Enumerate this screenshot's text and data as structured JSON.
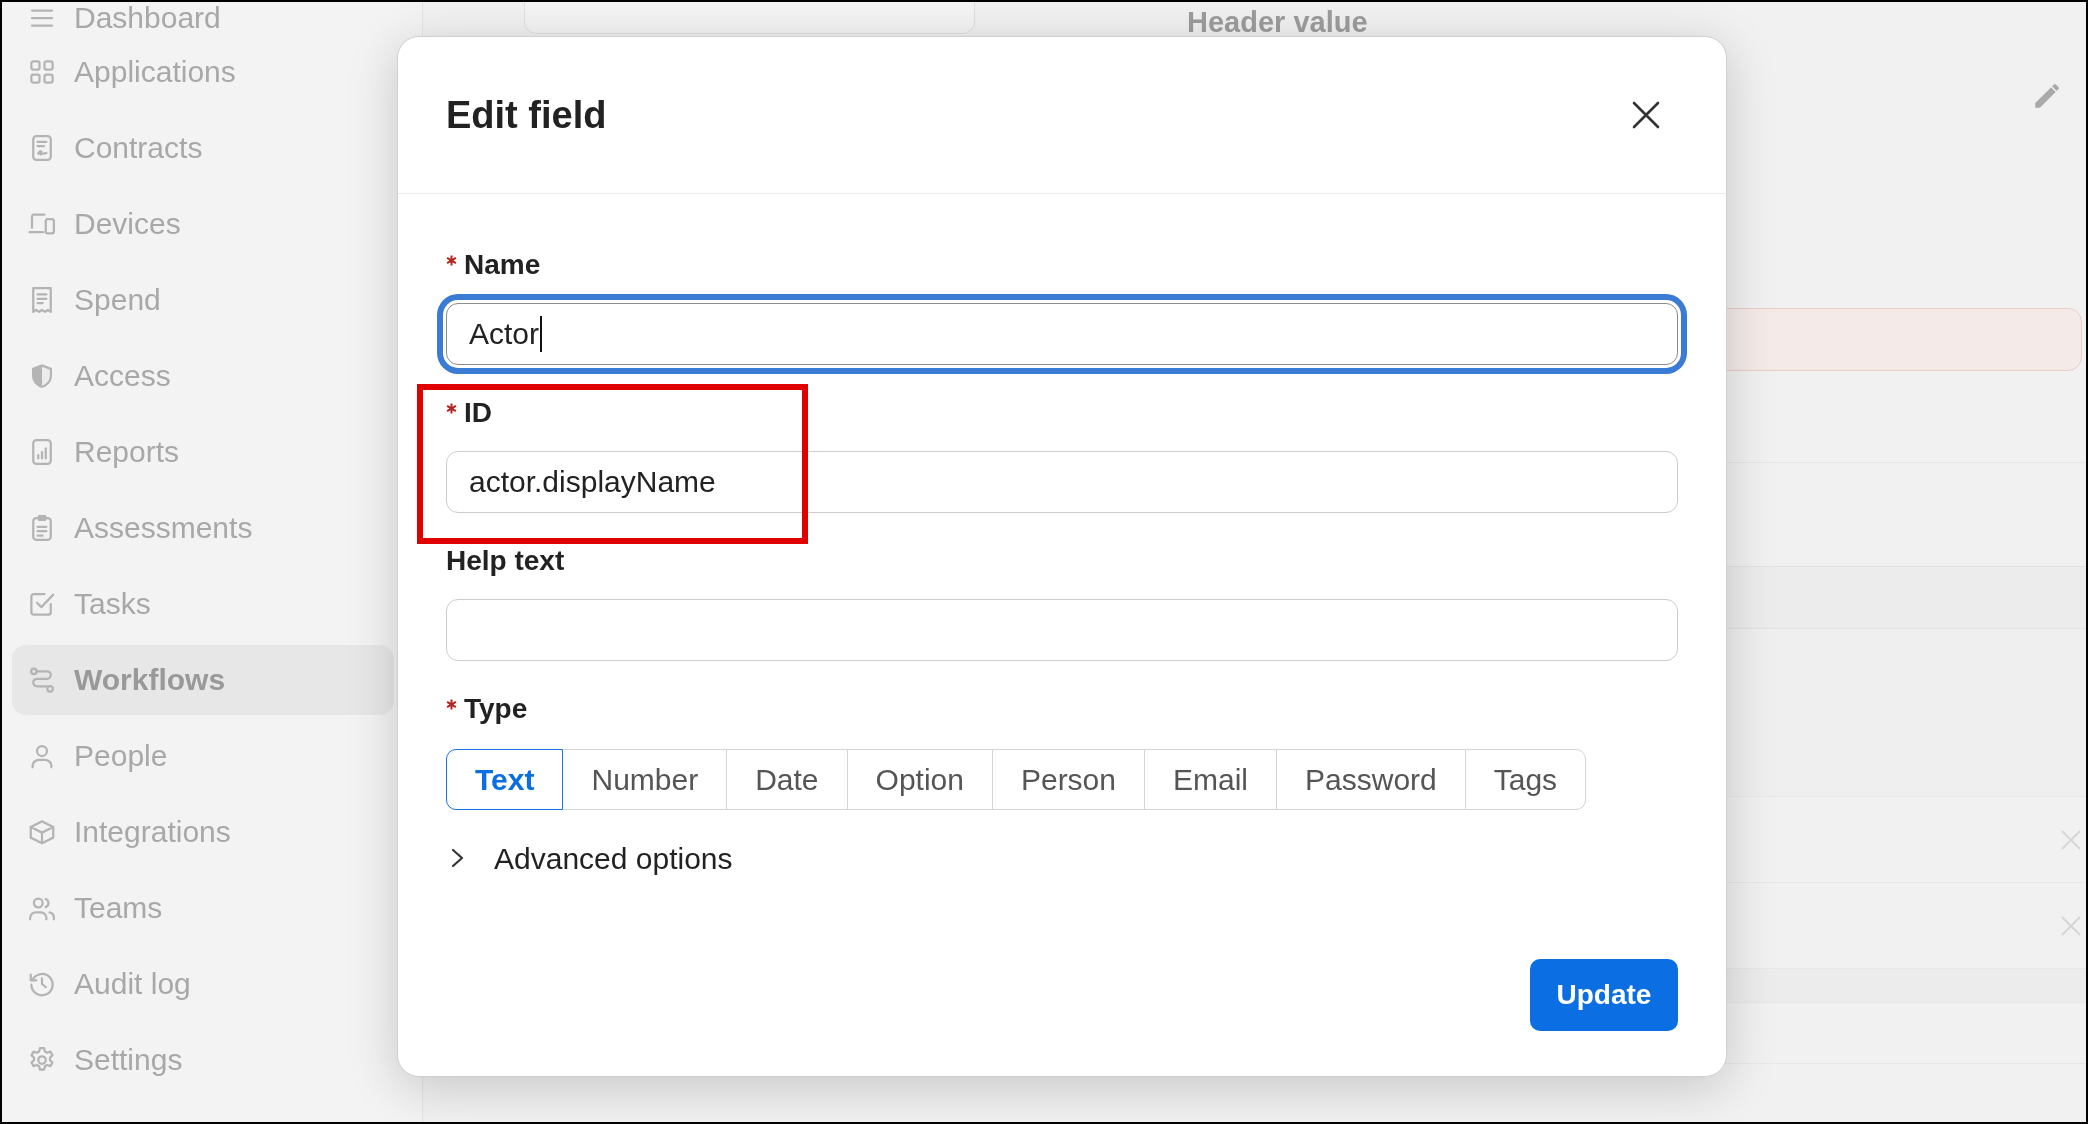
{
  "sidebar": {
    "items": [
      {
        "label": "Dashboard",
        "selected": false
      },
      {
        "label": "Applications",
        "selected": false
      },
      {
        "label": "Contracts",
        "selected": false
      },
      {
        "label": "Devices",
        "selected": false
      },
      {
        "label": "Spend",
        "selected": false
      },
      {
        "label": "Access",
        "selected": false
      },
      {
        "label": "Reports",
        "selected": false
      },
      {
        "label": "Assessments",
        "selected": false
      },
      {
        "label": "Tasks",
        "selected": false
      },
      {
        "label": "Workflows",
        "selected": true
      },
      {
        "label": "People",
        "selected": false
      },
      {
        "label": "Integrations",
        "selected": false
      },
      {
        "label": "Teams",
        "selected": false
      },
      {
        "label": "Audit log",
        "selected": false
      },
      {
        "label": "Settings",
        "selected": false
      }
    ]
  },
  "background": {
    "column_header": "Header value"
  },
  "dialog": {
    "title": "Edit field",
    "fields": [
      {
        "label": "Name",
        "required": true,
        "value": "Actor",
        "focused": true,
        "highlighted": false
      },
      {
        "label": "ID",
        "required": true,
        "value": "actor.displayName",
        "focused": false,
        "highlighted": true
      },
      {
        "label": "Help text",
        "required": false,
        "focused": false,
        "highlighted": false
      }
    ],
    "type_selector": {
      "label": "Type",
      "required": true,
      "options": [
        {
          "label": "Text",
          "selected": true
        },
        {
          "label": "Number",
          "selected": false
        },
        {
          "label": "Date",
          "selected": false
        },
        {
          "label": "Option",
          "selected": false
        },
        {
          "label": "Person",
          "selected": false
        },
        {
          "label": "Email",
          "selected": false
        },
        {
          "label": "Password",
          "selected": false
        },
        {
          "label": "Tags",
          "selected": false
        }
      ]
    },
    "advanced_options": {
      "label": "Advanced options",
      "expanded": false
    },
    "buttons": [
      {
        "label": "Update"
      }
    ]
  }
}
